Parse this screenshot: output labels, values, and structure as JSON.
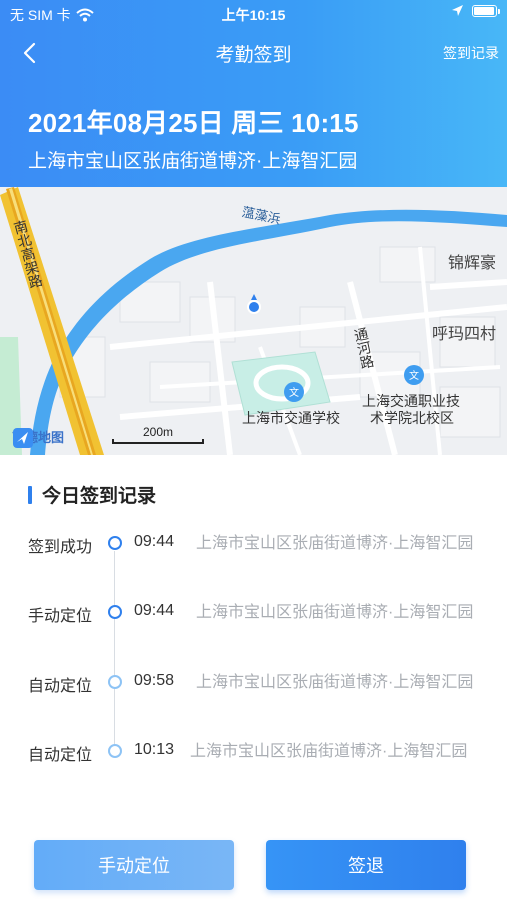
{
  "status_bar": {
    "carrier": "无 SIM 卡",
    "time": "上午10:15",
    "battery_level": 0.85
  },
  "nav": {
    "title": "考勤签到",
    "right_link": "签到记录"
  },
  "header": {
    "datetime": "2021年08月25日 周三 10:15",
    "address": "上海市宝山区张庙街道博济·上海智汇园"
  },
  "map": {
    "labels": {
      "river": "蕰藻浜",
      "road_left": "南北高架路",
      "road_mid": "通河路",
      "right_top": "锦辉豪",
      "right_mid": "呼玛四村",
      "school1": "上海市交通学校",
      "school2_line1": "上海交通职业技",
      "school2_line2": "术学院北校区",
      "provider": "高德地图",
      "scale": "200m"
    }
  },
  "records": {
    "title": "今日签到记录",
    "items": [
      {
        "status": "签到成功",
        "time": "09:44",
        "address": "上海市宝山区张庙街道博济·上海智汇园"
      },
      {
        "status": "手动定位",
        "time": "09:44",
        "address": "上海市宝山区张庙街道博济·上海智汇园"
      },
      {
        "status": "自动定位",
        "time": "09:58",
        "address": "上海市宝山区张庙街道博济·上海智汇园"
      },
      {
        "status": "自动定位",
        "time": "10:13",
        "address": "上海市宝山区张庙街道博济·上海智汇园"
      }
    ]
  },
  "buttons": {
    "manual": "手动定位",
    "signout": "签退"
  },
  "colors": {
    "accent": "#2f80ed",
    "header_gradient_start": "#3b8cf5",
    "header_gradient_end": "#48b7f7",
    "muted_text": "#a9adb3"
  }
}
